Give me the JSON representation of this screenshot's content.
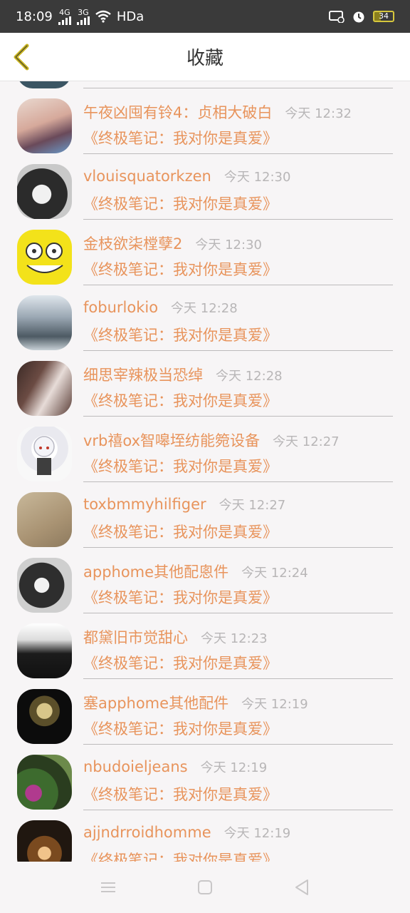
{
  "status": {
    "time": "18:09",
    "network_1": "4G",
    "network_2": "3G",
    "hd": "HDa",
    "battery": "34"
  },
  "header": {
    "title": "收藏"
  },
  "items": [
    {
      "name": "午夜凶囤有铃4：贞相大破白",
      "time": "今天 12:32",
      "book": "《终极笔记：我对你是真爱》"
    },
    {
      "name": "vlouisquatorkzen",
      "time": "今天 12:30",
      "book": "《终极笔记：我对你是真爱》"
    },
    {
      "name": "金枝欲柒樘孽2",
      "time": "今天 12:30",
      "book": "《终极笔记：我对你是真爱》"
    },
    {
      "name": "foburlokio",
      "time": "今天 12:28",
      "book": "《终极笔记：我对你是真爱》"
    },
    {
      "name": "细思宰辣极当恐绰",
      "time": "今天 12:28",
      "book": "《终极笔记：我对你是真爱》"
    },
    {
      "name": "vrb禧ox智嗥垤纺能箢设备",
      "time": "今天 12:27",
      "book": "《终极笔记：我对你是真爱》"
    },
    {
      "name": "toxbmmyhilfiger",
      "time": "今天 12:27",
      "book": "《终极笔记：我对你是真爱》"
    },
    {
      "name": "apphome其他配悤件",
      "time": "今天 12:24",
      "book": "《终极笔记：我对你是真爱》"
    },
    {
      "name": "都黛旧市觉甜心",
      "time": "今天 12:23",
      "book": "《终极笔记：我对你是真爱》"
    },
    {
      "name": "塞apphome其他配件",
      "time": "今天 12:19",
      "book": "《终极笔记：我对你是真爱》"
    },
    {
      "name": "nbudoieljeans",
      "time": "今天 12:19",
      "book": "《终极笔记：我对你是真爱》"
    },
    {
      "name": "ajjndrroidhomme",
      "time": "今天 12:19",
      "book": "《终极笔记：我对你是真爱》"
    }
  ],
  "colors": {
    "accent": "#e8945c",
    "time_gray": "#b8b6b7",
    "back_arrow": "#c9b51f"
  },
  "icons": {
    "back": "chevron-left-icon",
    "menu": "menu-icon",
    "home": "home-square-icon",
    "back_nav": "back-triangle-icon"
  }
}
